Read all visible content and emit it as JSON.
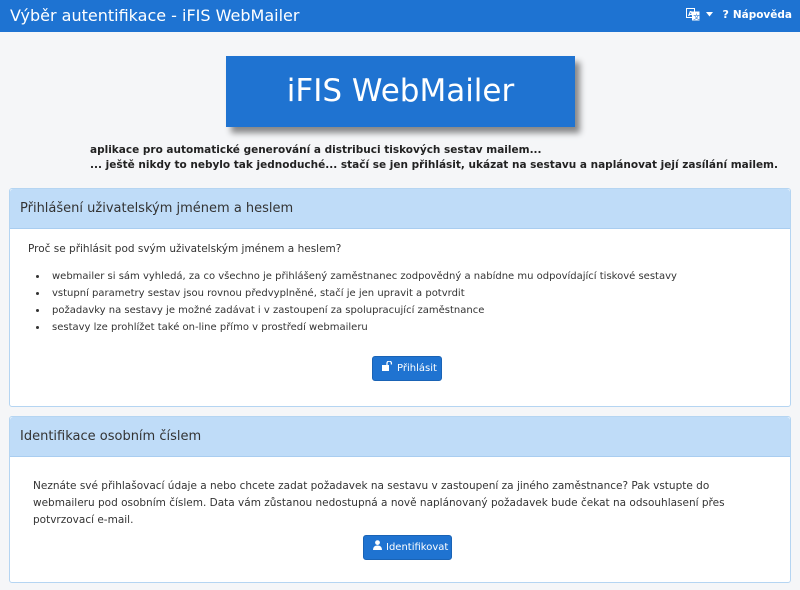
{
  "header": {
    "title": "Výběr autentifikace - iFIS WebMailer",
    "help_label": "Nápověda",
    "help_glyph": "?"
  },
  "banner": {
    "text": "iFIS WebMailer"
  },
  "tagline": {
    "line1": "aplikace pro automatické generování a distribuci tiskových sestav mailem...",
    "line2": "... ještě nikdy to nebylo tak jednoduché... stačí se jen přihlásit, ukázat na sestavu a naplánovat její zasílání mailem."
  },
  "login_panel": {
    "title": "Přihlášení uživatelským jménem a heslem",
    "intro": "Proč se přihlásit pod svým uživatelským jménem a heslem?",
    "items": [
      "webmailer si sám vyhledá, za co všechno je přihlášený zaměstnanec zodpovědný a nabídne mu odpovídající tiskové sestavy",
      "vstupní parametry sestav jsou rovnou předvyplněné, stačí je jen upravit a potvrdit",
      "požadavky na sestavy je možné zadávat i v zastoupení za spolupracující zaměstnance",
      "sestavy lze prohlížet také on-line přímo v prostředí webmaileru"
    ],
    "button_label": "Přihlásit"
  },
  "id_panel": {
    "title": "Identifikace osobním číslem",
    "text": "Neznáte své přihlašovací údaje a nebo chcete zadat požadavek na sestavu v zastoupení za jiného zaměstnance? Pak vstupte do webmaileru pod osobním číslem. Data vám zůstanou nedostupná a nově naplánovaný požadavek bude čekat na odsouhlasení přes potvrzovací e-mail.",
    "button_label": "Identifikovat"
  },
  "colors": {
    "brand": "#1e73d2",
    "panel_header": "#bfdcf8"
  },
  "icons": {
    "language": "translate-icon",
    "language_caret": "caret-down-icon",
    "help": "question-icon",
    "login": "unlock-icon",
    "identify": "user-icon"
  }
}
